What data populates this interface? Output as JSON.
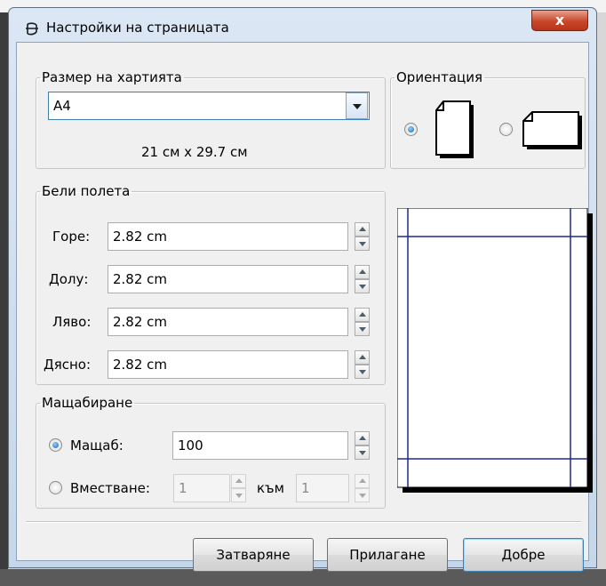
{
  "window": {
    "title": "Настройки на страницата",
    "close_glyph": "x"
  },
  "paper": {
    "legend": "Размер на хартията",
    "selected": "A4",
    "dimensions": "21 см x 29.7 см"
  },
  "orientation": {
    "legend": "Ориентация",
    "selected": "portrait"
  },
  "margins": {
    "legend": "Бели полета",
    "top_label": "Горе:",
    "top_value": "2.82 cm",
    "bottom_label": "Долу:",
    "bottom_value": "2.82 cm",
    "left_label": "Ляво:",
    "left_value": "2.82 cm",
    "right_label": "Дясно:",
    "right_value": "2.82 cm"
  },
  "scaling": {
    "legend": "Мащабиране",
    "scale_label": "Мащаб:",
    "scale_value": "100",
    "fit_label": "Вместване:",
    "fit_from": "1",
    "fit_to_label": "към",
    "fit_to": "1",
    "selected": "scale"
  },
  "buttons": {
    "close": "Затваряне",
    "apply": "Прилагане",
    "ok": "Добре"
  },
  "colors": {
    "accent": "#1e64b8",
    "preview_margin_line": "#1f2a8a",
    "close_button": "#c8462a"
  },
  "icons": {
    "title": "page-setup-icon",
    "portrait": "portrait-page-icon",
    "landscape": "landscape-page-icon",
    "dropdown": "chevron-down-icon"
  }
}
